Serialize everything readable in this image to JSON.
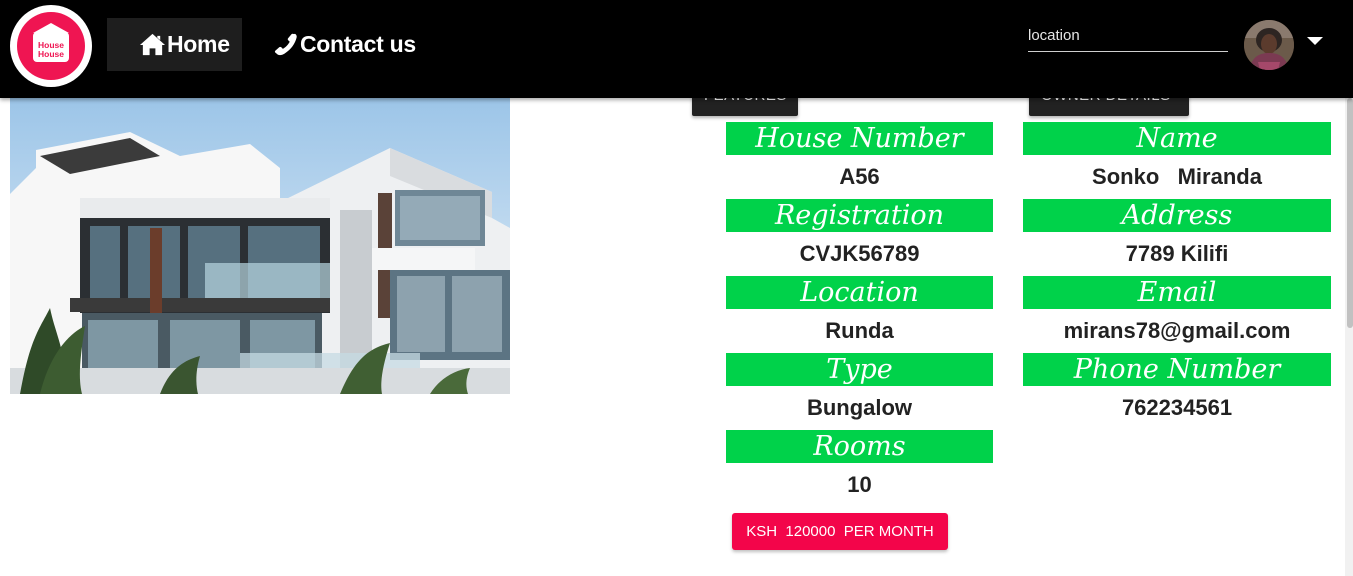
{
  "brand": {
    "logo_line1": "House",
    "logo_line2": "House",
    "accent": "#ef1552"
  },
  "nav": {
    "home_label": "Home",
    "home_icon": "home-icon",
    "contact_label": "Contact us",
    "contact_icon": "phone-icon"
  },
  "search": {
    "placeholder": "location",
    "value": ""
  },
  "user": {
    "avatar_icon": "user-avatar",
    "menu_icon": "caret-down-icon"
  },
  "tabs": {
    "features": "FEATURES",
    "owner": "OWNER DETAILS"
  },
  "features": [
    {
      "label": "House Number",
      "value": "A56"
    },
    {
      "label": "Registration",
      "value": "CVJK56789"
    },
    {
      "label": "Location",
      "value": "Runda"
    },
    {
      "label": "Type",
      "value": "Bungalow"
    },
    {
      "label": "Rooms",
      "value": "10"
    }
  ],
  "owner": [
    {
      "label": "Name",
      "value": "Sonko   Miranda"
    },
    {
      "label": "Address",
      "value": "7789 Kilifi"
    },
    {
      "label": "Email",
      "value": "mirans78@gmail.com"
    },
    {
      "label": "Phone Number",
      "value": "762234561"
    }
  ],
  "price": {
    "label": "KSH  120000  PER MONTH"
  },
  "colors": {
    "label_bg": "#00d24a",
    "price_bg": "#f3054a",
    "navbar_bg": "#000000"
  }
}
